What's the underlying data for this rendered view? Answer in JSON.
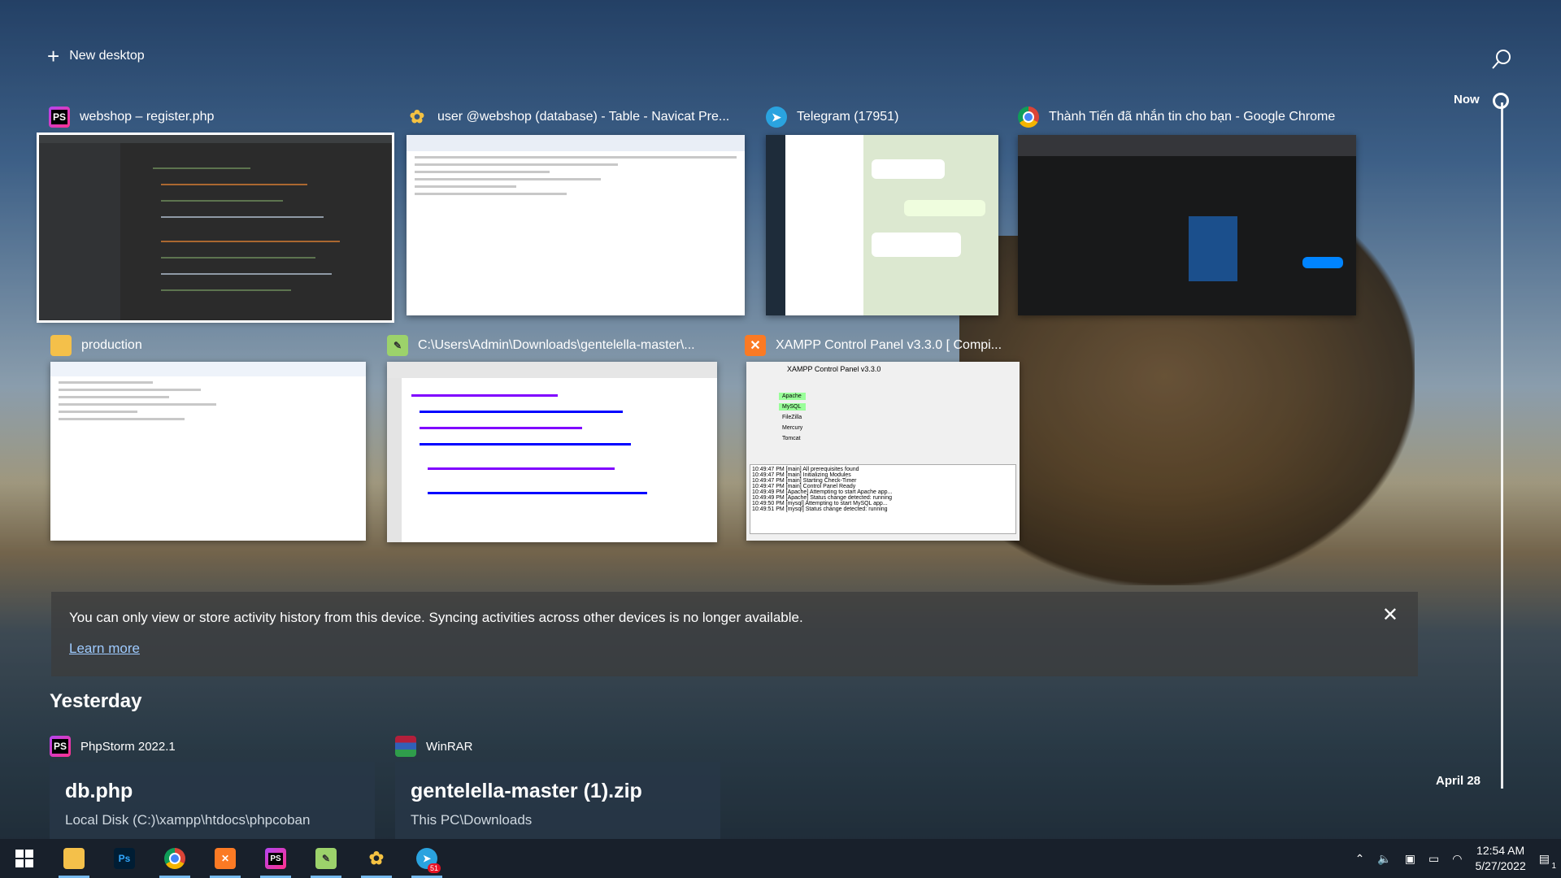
{
  "top": {
    "new_desktop_label": "New desktop"
  },
  "windows": [
    {
      "title": "webshop – register.php",
      "icon": "phpstorm-icon",
      "icon_text": "PS"
    },
    {
      "title": "user @webshop (database) - Table - Navicat Pre...",
      "icon": "navicat-icon"
    },
    {
      "title": "Telegram (17951)",
      "icon": "telegram-icon"
    },
    {
      "title": "Thành Tiến đã nhắn tin cho bạn - Google Chrome",
      "icon": "chrome-icon"
    },
    {
      "title": "production",
      "icon": "folder-icon"
    },
    {
      "title": "C:\\Users\\Admin\\Downloads\\gentelella-master\\...",
      "icon": "notepadpp-icon"
    },
    {
      "title": "XAMPP Control Panel v3.3.0   [ Compi...",
      "icon": "xampp-icon"
    }
  ],
  "xampp_thumb": {
    "header": "XAMPP Control Panel v3.3.0",
    "modules": [
      "Apache",
      "MySQL",
      "FileZilla",
      "Mercury",
      "Tomcat"
    ],
    "log": [
      "10:49:47 PM  [main]  All prerequisites found",
      "10:49:47 PM  [main]  Initializing Modules",
      "10:49:47 PM  [main]  Starting Check-Timer",
      "10:49:47 PM  [main]  Control Panel Ready",
      "10:49:49 PM  [Apache]  Attempting to start Apache app...",
      "10:49:49 PM  [Apache]  Status change detected: running",
      "10:49:50 PM  [mysql]  Attempting to start MySQL app...",
      "10:49:51 PM  [mysql]  Status change detected: running"
    ]
  },
  "banner": {
    "message": "You can only view or store activity history from this device. Syncing activities across other devices is no longer available.",
    "link": "Learn more",
    "close": "✕"
  },
  "history": {
    "heading": "Yesterday",
    "cards": [
      {
        "app": "PhpStorm 2022.1",
        "title": "db.php",
        "path": "Local Disk (C:)\\xampp\\htdocs\\phpcoban"
      },
      {
        "app": "WinRAR",
        "title": "gentelella-master (1).zip",
        "path": "This PC\\Downloads"
      }
    ]
  },
  "timeline": {
    "now": "Now",
    "date": "April 28"
  },
  "taskbar": {
    "apps": [
      "file-explorer-icon",
      "photoshop-icon",
      "chrome-icon",
      "xampp-icon",
      "phpstorm-icon",
      "notepadpp-icon",
      "navicat-icon",
      "telegram-icon"
    ],
    "telegram_badge": "51",
    "time": "12:54 AM",
    "date": "5/27/2022",
    "notification_count": "1"
  },
  "colors": {
    "accent": "#76b9ed",
    "banner_bg": "#3c3c3c",
    "link": "#9ecbff"
  }
}
